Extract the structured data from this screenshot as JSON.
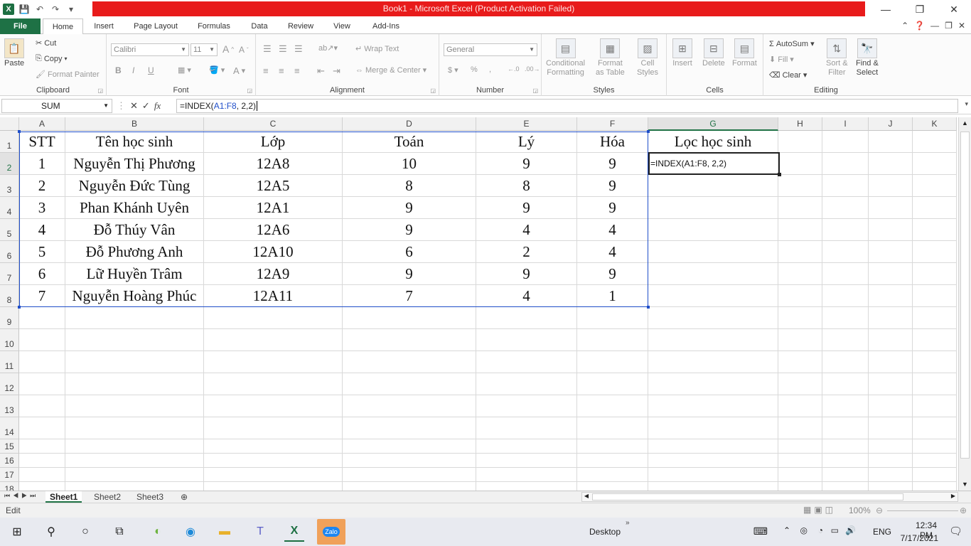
{
  "window": {
    "title": "Book1 - Microsoft Excel (Product Activation Failed)"
  },
  "qat": {
    "logo": "X",
    "save": "💾",
    "undo": "↶",
    "redo": "↷"
  },
  "tabs": [
    {
      "label": "File"
    },
    {
      "label": "Home"
    },
    {
      "label": "Insert"
    },
    {
      "label": "Page Layout"
    },
    {
      "label": "Formulas"
    },
    {
      "label": "Data"
    },
    {
      "label": "Review"
    },
    {
      "label": "View"
    },
    {
      "label": "Add-Ins"
    }
  ],
  "ribbon": {
    "clipboard": {
      "group": "Clipboard",
      "paste": "Paste",
      "cut": "Cut",
      "copy": "Copy",
      "format_painter": "Format Painter"
    },
    "font": {
      "group": "Font",
      "font_name": "Calibri",
      "font_size": "11",
      "bold": "B",
      "italic": "I",
      "underline": "U"
    },
    "alignment": {
      "group": "Alignment",
      "wrap_text": "Wrap Text",
      "merge_center": "Merge & Center"
    },
    "number": {
      "group": "Number",
      "format": "General",
      "currency": "$",
      "percent": "%",
      "comma": ","
    },
    "styles": {
      "group": "Styles",
      "conditional_1": "Conditional",
      "conditional_2": "Formatting",
      "format_table_1": "Format",
      "format_table_2": "as Table",
      "cell_styles_1": "Cell",
      "cell_styles_2": "Styles"
    },
    "cells": {
      "group": "Cells",
      "insert": "Insert",
      "delete": "Delete",
      "format": "Format"
    },
    "editing": {
      "group": "Editing",
      "autosum": "AutoSum",
      "fill": "Fill",
      "clear": "Clear",
      "sort_1": "Sort &",
      "sort_2": "Filter",
      "find_1": "Find &",
      "find_2": "Select"
    }
  },
  "formula_bar": {
    "name_box": "SUM",
    "fx": "fx",
    "formula_prefix": "=INDEX(",
    "formula_ref": "A1:F8",
    "formula_suffix": ", 2,2)"
  },
  "columns": [
    "A",
    "B",
    "C",
    "D",
    "E",
    "F",
    "G",
    "H",
    "I",
    "J",
    "K"
  ],
  "rows": [
    "1",
    "2",
    "3",
    "4",
    "5",
    "6",
    "7",
    "8",
    "9",
    "10",
    "11",
    "12",
    "13",
    "14",
    "15",
    "16",
    "17",
    "18"
  ],
  "sheet": {
    "headers": [
      "STT",
      "Tên học sinh",
      "Lớp",
      "Toán",
      "Lý",
      "Hóa",
      "Lọc học sinh"
    ],
    "data": [
      [
        "1",
        "Nguyễn Thị Phương",
        "12A8",
        "10",
        "9",
        "9"
      ],
      [
        "2",
        "Nguyễn Đức Tùng",
        "12A5",
        "8",
        "8",
        "9"
      ],
      [
        "3",
        "Phan Khánh Uyên",
        "12A1",
        "9",
        "9",
        "9"
      ],
      [
        "4",
        "Đỗ Thúy Vân",
        "12A6",
        "9",
        "4",
        "4"
      ],
      [
        "5",
        "Đỗ Phương Anh",
        "12A10",
        "6",
        "2",
        "4"
      ],
      [
        "6",
        "Lữ Huyền Trâm",
        "12A9",
        "9",
        "9",
        "9"
      ],
      [
        "7",
        "Nguyễn Hoàng Phúc",
        "12A11",
        "7",
        "4",
        "1"
      ]
    ],
    "active_cell_text": "=INDEX(A1:F8, 2,2)"
  },
  "sheet_tabs": [
    "Sheet1",
    "Sheet2",
    "Sheet3"
  ],
  "status": {
    "mode": "Edit",
    "zoom": "100%"
  },
  "taskbar": {
    "desktop": "Desktop",
    "language": "ENG",
    "time": "12:34 PM",
    "date": "7/17/2021",
    "zalo": "Zalo"
  }
}
